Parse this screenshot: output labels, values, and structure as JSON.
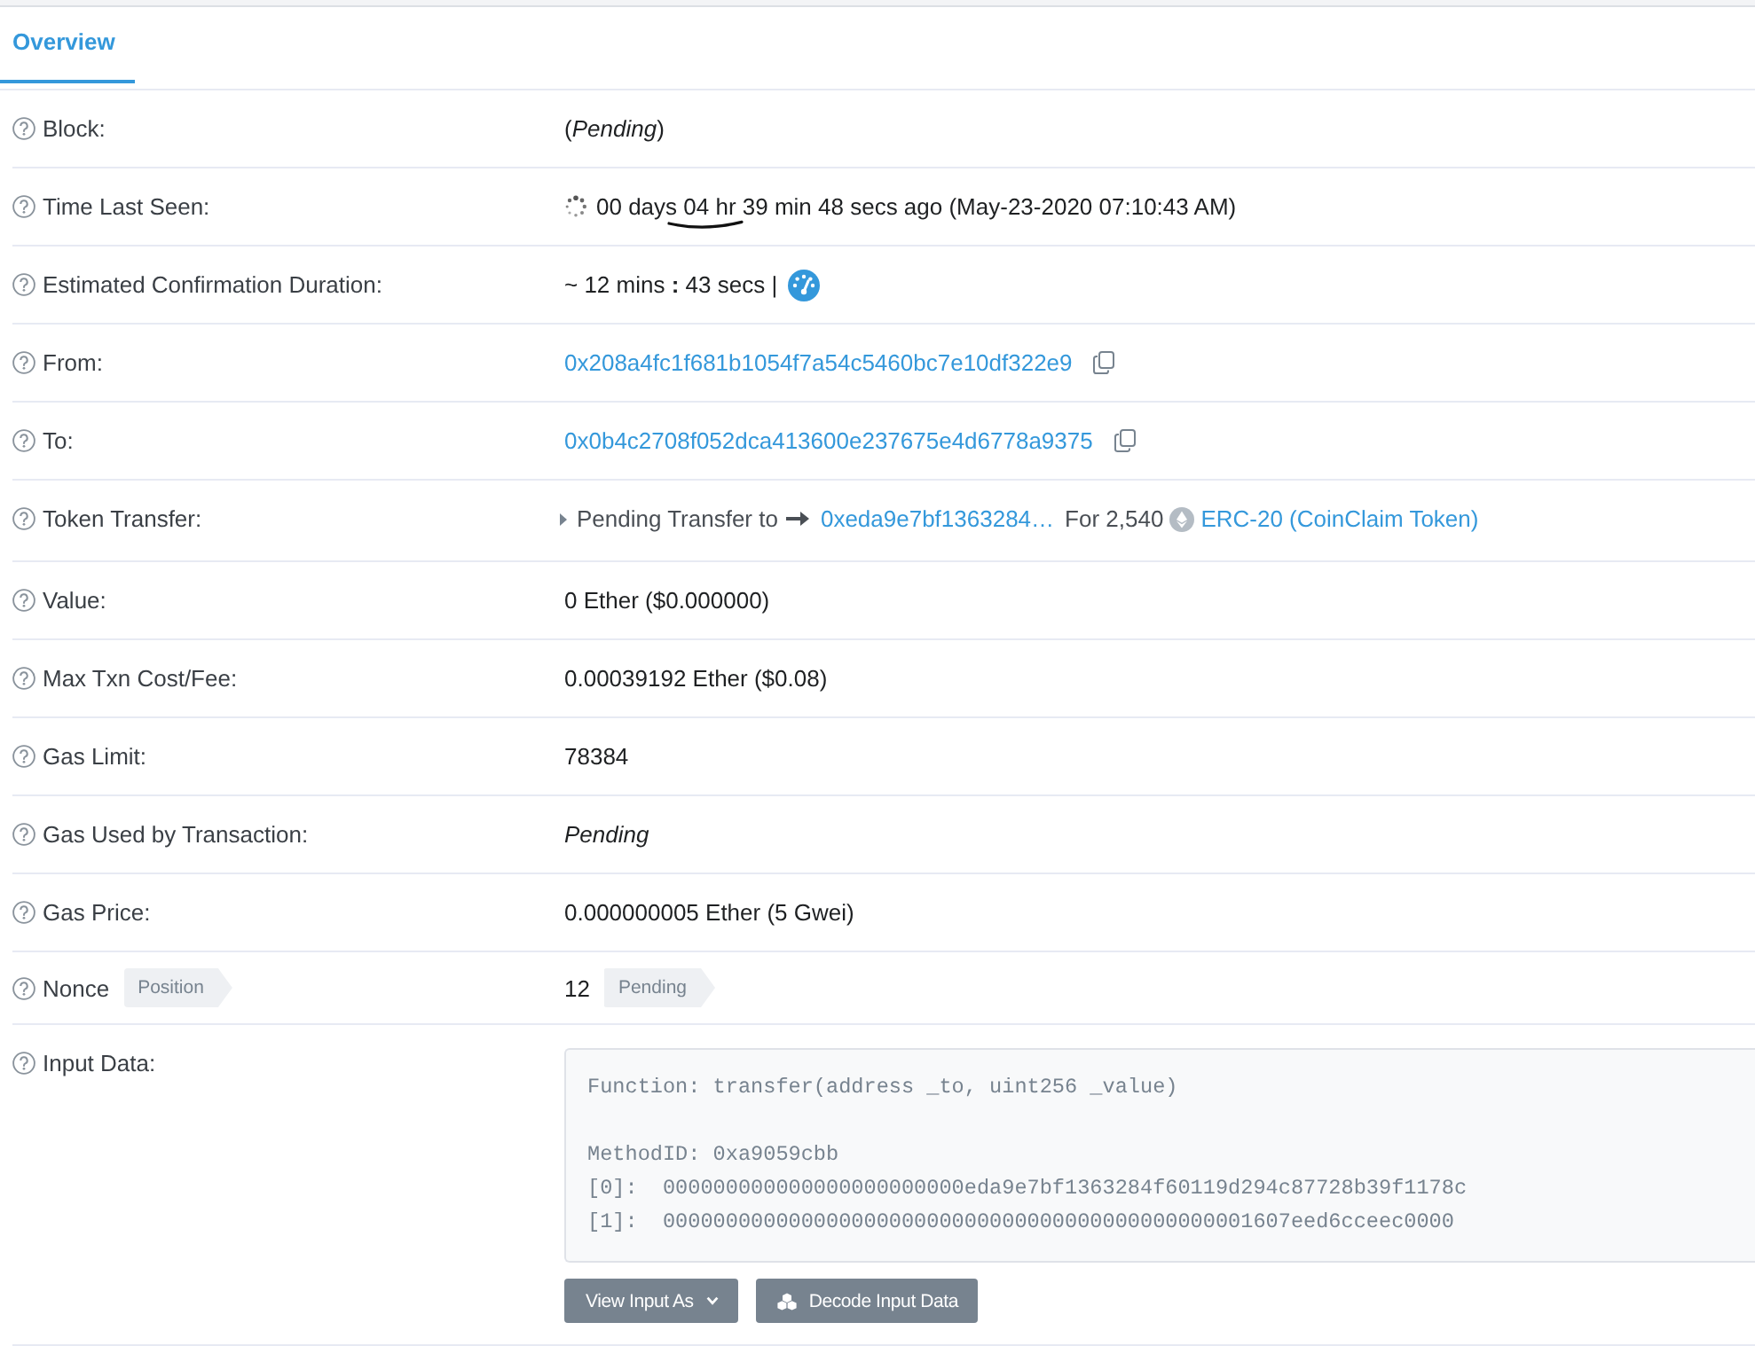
{
  "tabs": [
    {
      "label": "Overview",
      "selected": true
    }
  ],
  "rows": [
    {
      "kind": "text",
      "label": "Block:",
      "value": "(*Pending*)"
    },
    {
      "kind": "time",
      "label": "Time Last Seen:",
      "value": "00 days 04 hr 39 min 48 secs ago (May-23-2020 07:10:43 AM)"
    },
    {
      "kind": "duration",
      "label": "Estimated Confirmation Duration:",
      "value": "~ 12 mins **:** 43 secs |"
    },
    {
      "kind": "address",
      "label": "From:",
      "value": "0x208a4fc1f681b1054f7a54c5460bc7e10df322e9"
    },
    {
      "kind": "address",
      "label": "To:",
      "value": "0x0b4c2708f052dca413600e237675e4d6778a9375"
    },
    {
      "kind": "token_transfer",
      "label": "Token Transfer:",
      "prefix": "Pending Transfer to",
      "to": "0xeda9e7bf1363284…",
      "amount": "For 2,540",
      "token": "ERC-20 (CoinClaim Token)"
    },
    {
      "kind": "text",
      "label": "Value:",
      "value": "0 Ether ($0.000000)"
    },
    {
      "kind": "text",
      "label": "Max Txn Cost/Fee:",
      "value": "0.00039192 Ether ($0.08)"
    },
    {
      "kind": "text",
      "label": "Gas Limit:",
      "value": "78384"
    },
    {
      "kind": "status",
      "label": "Gas Used by Transaction:",
      "value": "Pending"
    },
    {
      "kind": "text",
      "label": "Gas Price:",
      "value": "0.000000005 Ether (5 Gwei)"
    },
    {
      "kind": "nonce",
      "label": "Nonce",
      "label_tag": "Position",
      "value": "12",
      "value_tag": "Pending"
    },
    {
      "kind": "input_data",
      "label": "Input Data:",
      "function_line": "Function: transfer(address _to, uint256 _value)",
      "method_id": "MethodID: 0xa9059cbb",
      "params": [
        "[0]:  000000000000000000000000eda9e7bf1363284f60119d294c87728b39f1178c",
        "[1]:  00000000000000000000000000000000000000000000001607eed6cceec0000"
      ],
      "buttons": [
        {
          "kind": "dropdown",
          "label": "View Input As"
        },
        {
          "kind": "decode",
          "label": "Decode Input Data"
        }
      ]
    }
  ]
}
